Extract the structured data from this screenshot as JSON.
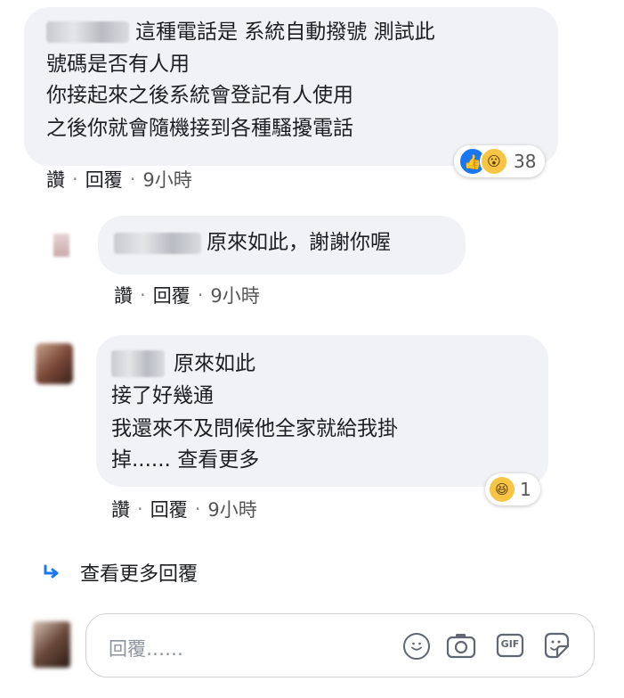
{
  "comments": [
    {
      "lines": [
        "這種電話是 系統自動撥號 測試此",
        "號碼是否有人用",
        "你接起來之後系統會登記有人使用",
        "之後你就會隨機接到各種騷擾電話"
      ],
      "actions": {
        "like": "讚",
        "reply": "回覆",
        "time": "9小時",
        "sep": "·"
      },
      "reactions": {
        "icons": [
          "like-icon",
          "wow-icon"
        ],
        "count": "38"
      }
    },
    {
      "lines": [
        "原來如此，謝謝你喔"
      ],
      "actions": {
        "like": "讚",
        "reply": "回覆",
        "time": "9小時",
        "sep": "·"
      }
    },
    {
      "lines": [
        "原來如此",
        "接了好幾通",
        "我還來不及問候他全家就給我掛",
        "掉......"
      ],
      "see_more": "查看更多",
      "actions": {
        "like": "讚",
        "reply": "回覆",
        "time": "9小時",
        "sep": "·"
      },
      "reactions": {
        "icons": [
          "haha-icon"
        ],
        "count": "1"
      }
    }
  ],
  "view_more_replies": "查看更多回覆",
  "reply_input": {
    "placeholder": "回覆……",
    "buttons": [
      "emoji-icon",
      "camera-icon",
      "gif-icon",
      "sticker-icon"
    ],
    "gif_label": "GIF"
  },
  "colors": {
    "bubble": "#f0f2f5",
    "like_blue": "#1877f2",
    "emoji_yellow": "#f7c544"
  }
}
